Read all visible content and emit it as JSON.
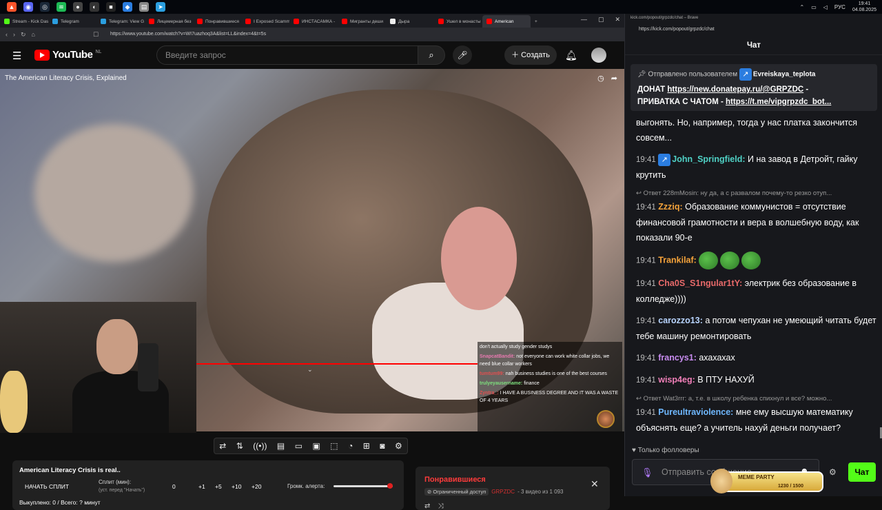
{
  "os": {
    "clock_time": "19:41",
    "clock_date": "04.08.2025",
    "lang": "РУС"
  },
  "tabs": [
    {
      "label": "Stream - Kick Das",
      "color": "#53fc18"
    },
    {
      "label": "Telegram",
      "color": "#2b9fe0"
    },
    {
      "label": "Telegram: View G",
      "color": "#2b9fe0"
    },
    {
      "label": "Лицемерная без",
      "color": "#ff0000"
    },
    {
      "label": "Понравившиеся",
      "color": "#ff0000"
    },
    {
      "label": "I Exposed Scamm",
      "color": "#ff0000"
    },
    {
      "label": "ИНСТАСАМКА -",
      "color": "#ff0000"
    },
    {
      "label": "Мигранты деши",
      "color": "#ff0000"
    },
    {
      "label": "Дыра",
      "color": "#eeeeee"
    },
    {
      "label": "Ушел в монасты",
      "color": "#ff0000"
    },
    {
      "label": "American",
      "color": "#ff0000",
      "active": true
    }
  ],
  "address": "https://www.youtube.com/watch?v=WI7uazhoq3A&list=LL&index=4&t=5s",
  "youtube": {
    "region": "NL",
    "search_placeholder": "Введите запрос",
    "create_label": "Создать"
  },
  "video": {
    "title": "The American Literacy Crisis, Explained"
  },
  "video_chat": [
    {
      "user": "",
      "text": "don't actually study gender studys",
      "color": "#ffffff"
    },
    {
      "user": "SnapcatBandit:",
      "text": "not everyone can work white collar jobs, we need blue collar workers",
      "color": "#e87ab0"
    },
    {
      "user": "tumtum99:",
      "text": "nah business studies is one of the best courses",
      "color": "#e05050"
    },
    {
      "user": "trulyeyausername:",
      "text": "finance",
      "color": "#7ee07e"
    },
    {
      "user": "Zyntra_:",
      "text": "I HAVE A BUSINESS DEGREE AND IT WAS A WASTE OF 4 YEARS",
      "color": "#e05050"
    }
  ],
  "split": {
    "title": "American Literacy Crisis is real..",
    "start_label": "НАЧАТЬ СПЛИТ",
    "split_label": "Сплит (мин):",
    "split_sub": "(уст. перед \"Начать\")",
    "split_value": "0",
    "increments": [
      "+1",
      "+5",
      "+10",
      "+20"
    ],
    "alert_label": "Громк. алерта:",
    "alert_level": 0.95,
    "footer": "Выкуплено: 0 / Всего: ? минут"
  },
  "liked": {
    "title": "Понравившиеся",
    "access": "Ограниченный доступ",
    "author": "GRPZDC",
    "meta": "- 3 видео из 1 093"
  },
  "chat": {
    "window_title": "kick.com/popout/grpzdc/chat – Brave",
    "url": "https://kick.com/popout/grpzdc/chat",
    "header": "Чат",
    "pinned_prefix": "Отправлено пользователем",
    "pinned_user": "Evreiskaya_teplota",
    "pinned_line1_prefix": "ДОНАТ ",
    "pinned_link1": "https://new.donatepay.ru/@GRPZDC",
    "pinned_line1_suffix": " -",
    "pinned_line2_prefix": "ПРИВАТКА С ЧАТОМ - ",
    "pinned_link2": "https://t.me/vipgrpzdc_bot...",
    "followers_only": "Только фолловеры",
    "input_placeholder": "Отправить сообщение",
    "send_label": "Чат",
    "meme_title": "MEME PARTY",
    "meme_count": "1230 / 1500"
  },
  "chat_messages": [
    {
      "time": "",
      "user": "",
      "color": "#ffffff",
      "text": "выгонять. Но, например, тогда у нас платка закончится совсем...",
      "reply": ""
    },
    {
      "time": "19:41",
      "user": "John_Springfield:",
      "color": "#4fd1c5",
      "badge": true,
      "text": "И на завод в Детройт, гайку крутить",
      "reply": ""
    },
    {
      "time": "19:41",
      "user": "Zzziq:",
      "color": "#f6a33a",
      "text": "Образование коммунистов = отсутствие финансовой грамотности и вера в волшебную воду, как показали 90-е",
      "reply": "Ответ 228mMosin: ну да, а с развалом почему-то резко отуп..."
    },
    {
      "time": "19:41",
      "user": "Trankilaf:",
      "color": "#f6a33a",
      "text": "",
      "emotes": 3,
      "reply": ""
    },
    {
      "time": "19:41",
      "user": "Cha0S_S1ngular1tY:",
      "color": "#e86a6a",
      "text": "электрик без образование в колледже))))",
      "reply": ""
    },
    {
      "time": "19:41",
      "user": "carozzo13:",
      "color": "#b8d4ff",
      "text": "а потом чепухан не умеющий читать будет тебе машину ремонтировать",
      "reply": ""
    },
    {
      "time": "19:41",
      "user": "francys1:",
      "color": "#c88cf0",
      "text": "ахахахах",
      "reply": ""
    },
    {
      "time": "19:41",
      "user": "wisp4eg:",
      "color": "#f07fb8",
      "text": "В ПТУ НАХУЙ",
      "reply": ""
    },
    {
      "time": "19:41",
      "user": "Pureultraviolence:",
      "color": "#6fb8ff",
      "text": "мне ему высшую математику объяснять еще? а учитель нахуй деньги получает?",
      "reply": "Ответ Wat3rrr: а, т.е. в школу ребенка спихнул и все? можно..."
    }
  ]
}
